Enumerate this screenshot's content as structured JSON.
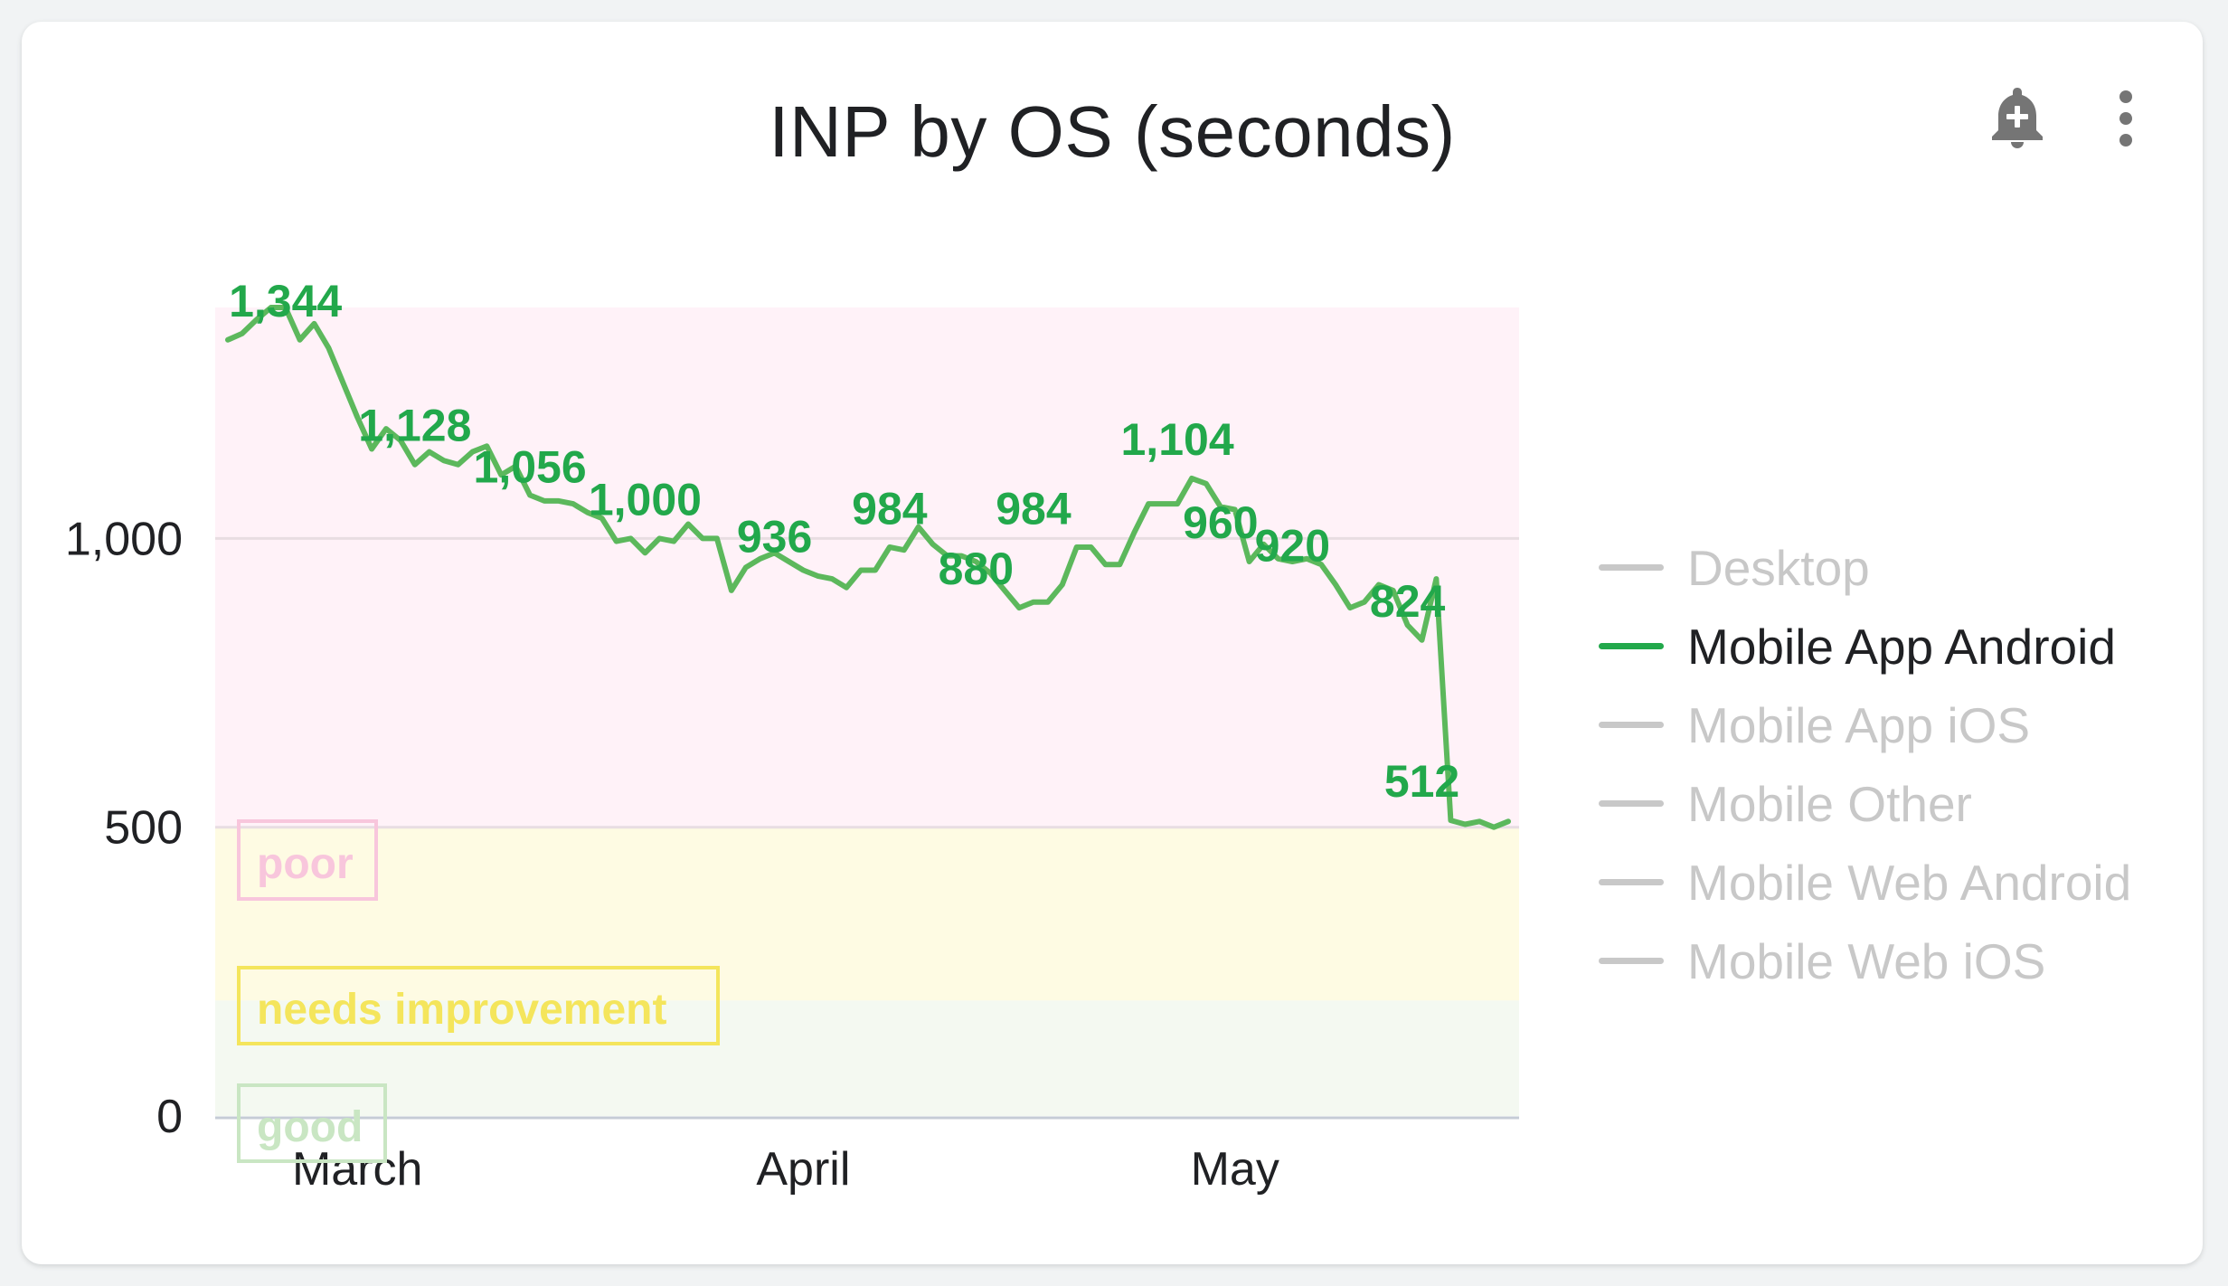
{
  "card": {
    "title": "INP by OS (seconds)",
    "add_alert_icon": "add-alert-bell-icon",
    "more_icon": "more-vert-icon"
  },
  "colors": {
    "series": "#22a84b",
    "line": "#5cb85c",
    "legend_inactive": "#c8c8c8",
    "poor_band": "#fff2f8",
    "needs_improvement_band": "#fefbe3",
    "good_band": "#f4f9f1",
    "poor_label": "#f8c6dc",
    "needs_improvement_label": "#f4e55c",
    "good_label": "#c9e6c3",
    "icon": "#757575"
  },
  "legend": {
    "items": [
      {
        "label": "Desktop",
        "active": false
      },
      {
        "label": "Mobile App Android",
        "active": true
      },
      {
        "label": "Mobile App iOS",
        "active": false
      },
      {
        "label": "Mobile Other",
        "active": false
      },
      {
        "label": "Mobile Web Android",
        "active": false
      },
      {
        "label": "Mobile Web iOS",
        "active": false
      }
    ]
  },
  "chart_data": {
    "type": "line",
    "title": "INP by OS (seconds)",
    "xlabel": "",
    "ylabel": "",
    "ylim": [
      0,
      1400
    ],
    "xlim": [
      "2024-02-21",
      "2024-05-20"
    ],
    "y_ticks": [
      0,
      500,
      1000
    ],
    "y_tick_labels": [
      "0",
      "500",
      "1,000"
    ],
    "x_ticks": [
      {
        "date": "2024-03-01",
        "label": "March"
      },
      {
        "date": "2024-04-01",
        "label": "April"
      },
      {
        "date": "2024-05-01",
        "label": "May"
      }
    ],
    "grid": true,
    "legend_position": "right",
    "thresholds": [
      {
        "label": "good",
        "from": 0,
        "to": 200
      },
      {
        "label": "needs improvement",
        "from": 200,
        "to": 500
      },
      {
        "label": "poor",
        "from": 500,
        "to": 1400
      }
    ],
    "series": [
      {
        "name": "Mobile App Android",
        "points": [
          [
            "2024-02-21",
            1344
          ],
          [
            "2024-02-22",
            1355
          ],
          [
            "2024-02-23",
            1379
          ],
          [
            "2024-02-24",
            1400
          ],
          [
            "2024-02-25",
            1400
          ],
          [
            "2024-02-26",
            1344
          ],
          [
            "2024-02-27",
            1372
          ],
          [
            "2024-02-28",
            1330
          ],
          [
            "2024-02-29",
            1270
          ],
          [
            "2024-03-01",
            1210
          ],
          [
            "2024-03-02",
            1155
          ],
          [
            "2024-03-03",
            1190
          ],
          [
            "2024-03-04",
            1170
          ],
          [
            "2024-03-05",
            1128
          ],
          [
            "2024-03-06",
            1150
          ],
          [
            "2024-03-07",
            1135
          ],
          [
            "2024-03-08",
            1128
          ],
          [
            "2024-03-09",
            1150
          ],
          [
            "2024-03-10",
            1160
          ],
          [
            "2024-03-11",
            1110
          ],
          [
            "2024-03-12",
            1125
          ],
          [
            "2024-03-13",
            1075
          ],
          [
            "2024-03-14",
            1065
          ],
          [
            "2024-03-15",
            1065
          ],
          [
            "2024-03-16",
            1060
          ],
          [
            "2024-03-17",
            1045
          ],
          [
            "2024-03-18",
            1035
          ],
          [
            "2024-03-19",
            995
          ],
          [
            "2024-03-20",
            1000
          ],
          [
            "2024-03-21",
            975
          ],
          [
            "2024-03-22",
            1000
          ],
          [
            "2024-03-23",
            995
          ],
          [
            "2024-03-24",
            1025
          ],
          [
            "2024-03-25",
            1000
          ],
          [
            "2024-03-26",
            1000
          ],
          [
            "2024-03-27",
            910
          ],
          [
            "2024-03-28",
            950
          ],
          [
            "2024-03-29",
            965
          ],
          [
            "2024-03-30",
            975
          ],
          [
            "2024-03-31",
            960
          ],
          [
            "2024-04-01",
            945
          ],
          [
            "2024-04-02",
            935
          ],
          [
            "2024-04-03",
            930
          ],
          [
            "2024-04-04",
            915
          ],
          [
            "2024-04-05",
            945
          ],
          [
            "2024-04-06",
            945
          ],
          [
            "2024-04-07",
            985
          ],
          [
            "2024-04-08",
            980
          ],
          [
            "2024-04-09",
            1020
          ],
          [
            "2024-04-10",
            990
          ],
          [
            "2024-04-11",
            970
          ],
          [
            "2024-04-12",
            970
          ],
          [
            "2024-04-13",
            960
          ],
          [
            "2024-04-14",
            940
          ],
          [
            "2024-04-15",
            910
          ],
          [
            "2024-04-16",
            880
          ],
          [
            "2024-04-17",
            890
          ],
          [
            "2024-04-18",
            890
          ],
          [
            "2024-04-19",
            920
          ],
          [
            "2024-04-20",
            985
          ],
          [
            "2024-04-21",
            985
          ],
          [
            "2024-04-22",
            955
          ],
          [
            "2024-04-23",
            955
          ],
          [
            "2024-04-24",
            1010
          ],
          [
            "2024-04-25",
            1060
          ],
          [
            "2024-04-26",
            1060
          ],
          [
            "2024-04-27",
            1060
          ],
          [
            "2024-04-28",
            1104
          ],
          [
            "2024-04-29",
            1095
          ],
          [
            "2024-04-30",
            1055
          ],
          [
            "2024-05-01",
            1050
          ],
          [
            "2024-05-02",
            960
          ],
          [
            "2024-05-03",
            990
          ],
          [
            "2024-05-04",
            965
          ],
          [
            "2024-05-05",
            960
          ],
          [
            "2024-05-06",
            965
          ],
          [
            "2024-05-07",
            955
          ],
          [
            "2024-05-08",
            920
          ],
          [
            "2024-05-09",
            880
          ],
          [
            "2024-05-10",
            890
          ],
          [
            "2024-05-11",
            920
          ],
          [
            "2024-05-12",
            910
          ],
          [
            "2024-05-13",
            850
          ],
          [
            "2024-05-14",
            824
          ],
          [
            "2024-05-15",
            930
          ],
          [
            "2024-05-16",
            512
          ],
          [
            "2024-05-17",
            505
          ],
          [
            "2024-05-18",
            510
          ],
          [
            "2024-05-19",
            500
          ],
          [
            "2024-05-20",
            510
          ]
        ]
      }
    ],
    "data_labels": [
      {
        "date": "2024-02-25",
        "value": 1344,
        "text": "1,344"
      },
      {
        "date": "2024-03-05",
        "value": 1128,
        "text": "1,128"
      },
      {
        "date": "2024-03-13",
        "value": 1056,
        "text": "1,056"
      },
      {
        "date": "2024-03-21",
        "value": 1000,
        "text": "1,000"
      },
      {
        "date": "2024-03-30",
        "value": 936,
        "text": "936"
      },
      {
        "date": "2024-04-07",
        "value": 984,
        "text": "984"
      },
      {
        "date": "2024-04-13",
        "value": 880,
        "text": "880"
      },
      {
        "date": "2024-04-17",
        "value": 984,
        "text": "984"
      },
      {
        "date": "2024-04-27",
        "value": 1104,
        "text": "1,104"
      },
      {
        "date": "2024-04-30",
        "value": 960,
        "text": "960"
      },
      {
        "date": "2024-05-05",
        "value": 920,
        "text": "920"
      },
      {
        "date": "2024-05-13",
        "value": 824,
        "text": "824"
      },
      {
        "date": "2024-05-14",
        "value": 512,
        "text": "512"
      }
    ]
  }
}
